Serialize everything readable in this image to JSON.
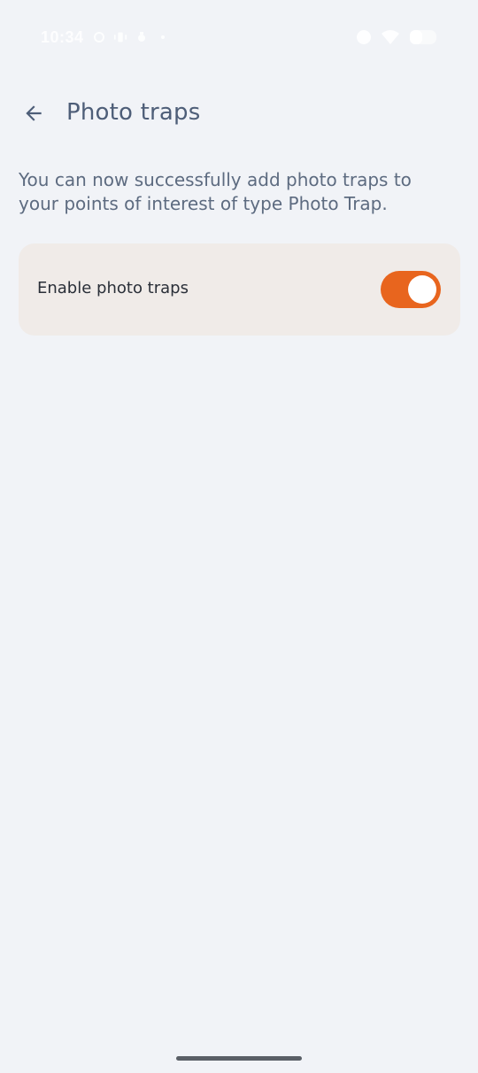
{
  "status_bar": {
    "time": "10:34",
    "left_icons": [
      "sync-icon",
      "vibrate-icon",
      "cast-icon",
      "dot-icon"
    ],
    "right_icons": [
      "alarm-icon",
      "wifi-icon",
      "battery-icon"
    ]
  },
  "app_bar": {
    "title": "Photo traps",
    "back_icon": "arrow-back-icon"
  },
  "description": "You can now successfully add photo traps to your points of interest of type Photo Trap.",
  "setting": {
    "label": "Enable photo traps",
    "enabled": true
  },
  "colors": {
    "background": "#f1f3f7",
    "accent": "#e8651e",
    "card": "#f0ebe8",
    "title": "#4e5e78"
  }
}
